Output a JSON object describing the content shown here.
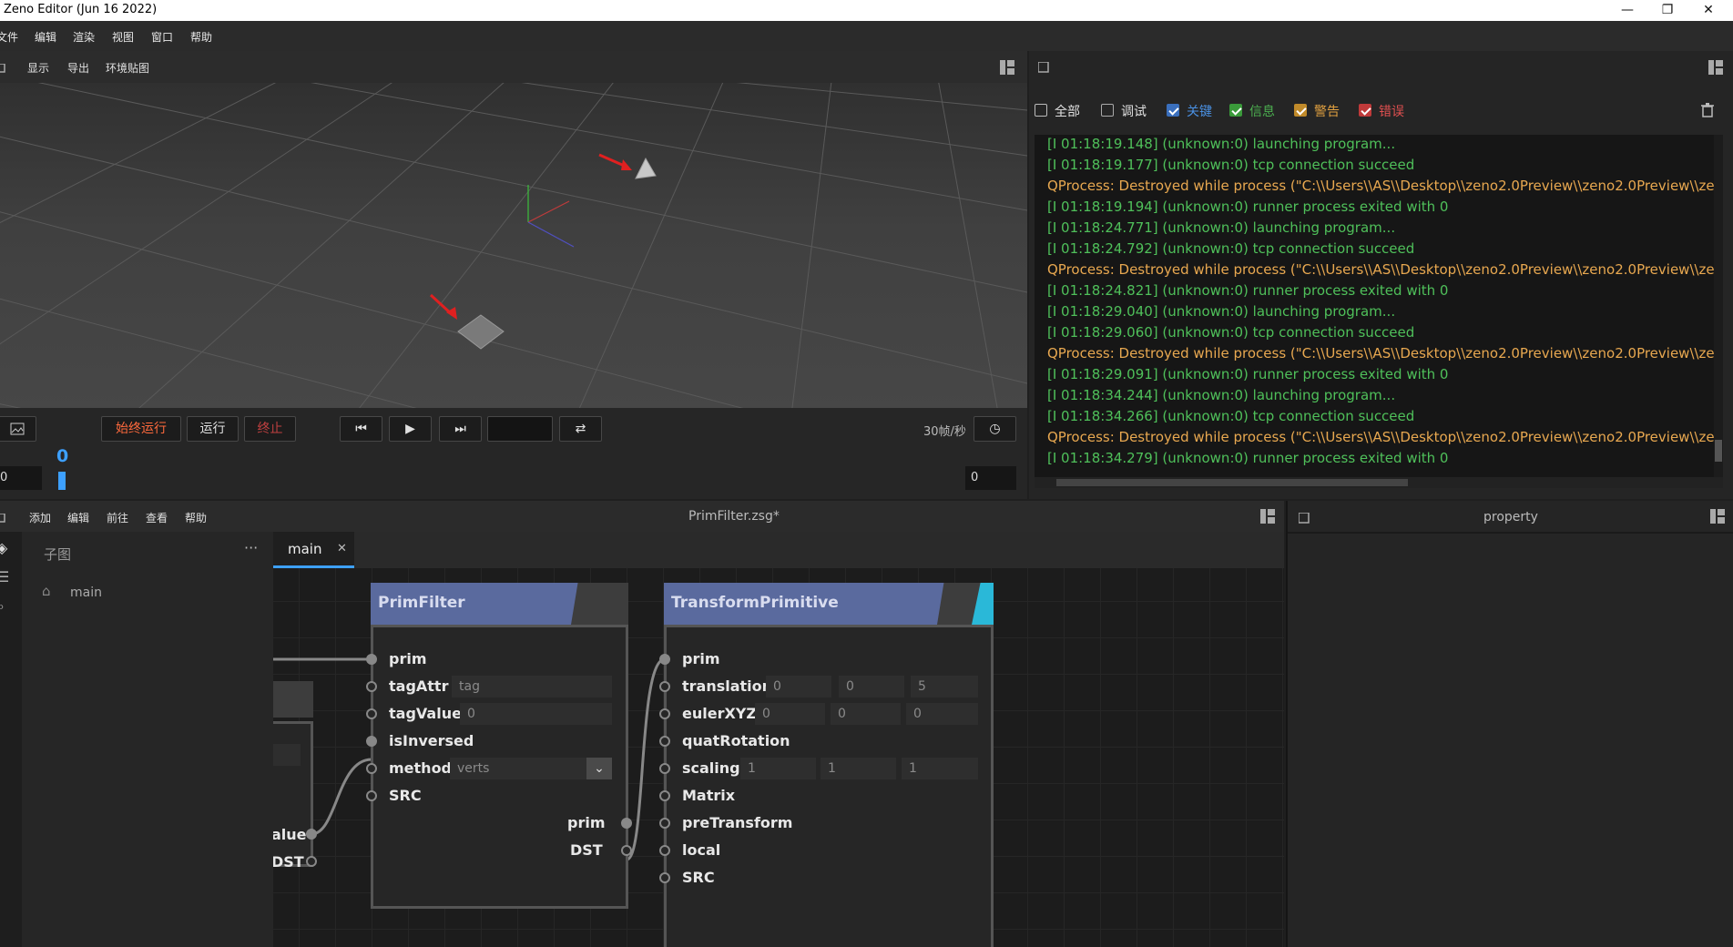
{
  "window": {
    "title": "Zeno Editor (Jun 16 2022)",
    "minimize": "—",
    "restore": "❐",
    "close": "✕"
  },
  "menubar": {
    "items": [
      "文件",
      "编辑",
      "渲染",
      "视图",
      "窗口",
      "帮助"
    ]
  },
  "viewport": {
    "toolbar": [
      "显示",
      "导出",
      "环境贴图"
    ],
    "buttons": {
      "always_run": "始终运行",
      "run": "运行",
      "stop": "终止"
    },
    "fps": "30帧/秒",
    "current_frame": "0",
    "start_frame": "0",
    "end_frame": "0"
  },
  "log": {
    "filters": [
      {
        "label": "全部",
        "checked": true,
        "color": "#e0e0e0"
      },
      {
        "label": "调试",
        "checked": false,
        "color": "#e0e0e0"
      },
      {
        "label": "关键",
        "checked": true,
        "color": "#4a90e2"
      },
      {
        "label": "信息",
        "checked": true,
        "color": "#4caf50"
      },
      {
        "label": "警告",
        "checked": true,
        "color": "#e0a040"
      },
      {
        "label": "错误",
        "checked": true,
        "color": "#e05050"
      }
    ],
    "lines": [
      {
        "text": "[I 01:18:19.148] (unknown:0) launching program...",
        "level": "info"
      },
      {
        "text": "[I 01:18:19.177] (unknown:0) tcp connection succeed",
        "level": "info"
      },
      {
        "text": "QProcess: Destroyed while process (\"C:\\\\Users\\\\AS\\\\Desktop\\\\zeno2.0Preview\\\\zeno2.0Preview\\\\zenoe",
        "level": "warn"
      },
      {
        "text": "[I 01:18:19.194] (unknown:0) runner process exited with 0",
        "level": "info"
      },
      {
        "text": "[I 01:18:24.771] (unknown:0) launching program...",
        "level": "info"
      },
      {
        "text": "[I 01:18:24.792] (unknown:0) tcp connection succeed",
        "level": "info"
      },
      {
        "text": "QProcess: Destroyed while process (\"C:\\\\Users\\\\AS\\\\Desktop\\\\zeno2.0Preview\\\\zeno2.0Preview\\\\zenoe",
        "level": "warn"
      },
      {
        "text": "[I 01:18:24.821] (unknown:0) runner process exited with 0",
        "level": "info"
      },
      {
        "text": "[I 01:18:29.040] (unknown:0) launching program...",
        "level": "info"
      },
      {
        "text": "[I 01:18:29.060] (unknown:0) tcp connection succeed",
        "level": "info"
      },
      {
        "text": "QProcess: Destroyed while process (\"C:\\\\Users\\\\AS\\\\Desktop\\\\zeno2.0Preview\\\\zeno2.0Preview\\\\zenoe",
        "level": "warn"
      },
      {
        "text": "[I 01:18:29.091] (unknown:0) runner process exited with 0",
        "level": "info"
      },
      {
        "text": "[I 01:18:34.244] (unknown:0) launching program...",
        "level": "info"
      },
      {
        "text": "[I 01:18:34.266] (unknown:0) tcp connection succeed",
        "level": "info"
      },
      {
        "text": "QProcess: Destroyed while process (\"C:\\\\Users\\\\AS\\\\Desktop\\\\zeno2.0Preview\\\\zeno2.0Preview\\\\zenoe",
        "level": "warn"
      },
      {
        "text": "[I 01:18:34.279] (unknown:0) runner process exited with 0",
        "level": "info"
      }
    ],
    "colors": {
      "info": "#4fc05a",
      "warn": "#e8a850"
    }
  },
  "node_editor": {
    "menu": [
      "添加",
      "编辑",
      "前往",
      "查看",
      "帮助"
    ],
    "file_title": "PrimFilter.zsg*",
    "subgraph": {
      "title": "子图",
      "more": "···",
      "items": [
        "main"
      ]
    },
    "tab": {
      "label": "main",
      "close": "✕"
    },
    "left_partial_node": {
      "sockets": [
        "alue",
        "DST"
      ]
    },
    "prim_filter": {
      "title": "PrimFilter",
      "inputs": [
        {
          "name": "prim"
        },
        {
          "name": "tagAttr",
          "value": "tag"
        },
        {
          "name": "tagValue",
          "value": "0"
        },
        {
          "name": "isInversed"
        },
        {
          "name": "method",
          "value": "verts"
        },
        {
          "name": "SRC"
        }
      ],
      "outputs": [
        "prim",
        "DST"
      ]
    },
    "transform_primitive": {
      "title": "TransformPrimitive",
      "inputs": [
        {
          "name": "prim"
        },
        {
          "name": "translation",
          "values": [
            "0",
            "0",
            "5"
          ]
        },
        {
          "name": "eulerXYZ",
          "values": [
            "0",
            "0",
            "0"
          ]
        },
        {
          "name": "quatRotation"
        },
        {
          "name": "scaling",
          "values": [
            "1",
            "1",
            "1"
          ]
        },
        {
          "name": "Matrix"
        },
        {
          "name": "preTransform"
        },
        {
          "name": "local"
        },
        {
          "name": "SRC"
        }
      ]
    }
  },
  "property": {
    "title": "property"
  }
}
